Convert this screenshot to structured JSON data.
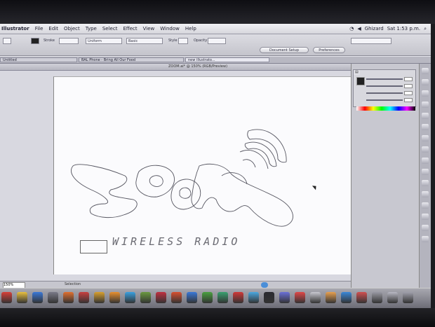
{
  "menubar": {
    "app_name": "Illustrator",
    "items": [
      "File",
      "Edit",
      "Object",
      "Type",
      "Select",
      "Effect",
      "View",
      "Window",
      "Help"
    ],
    "user": "Ghizard",
    "clock": "Sat 1:53 p.m."
  },
  "control_bar": {
    "stroke_label": "Stroke",
    "uniform_label": "Uniform",
    "basic_label": "Basic",
    "style_label": "Style",
    "opacity_label": "Opacity",
    "document_setup": "Document Setup",
    "preferences": "Preferences"
  },
  "tabs": [
    "Untitled",
    "BAL Phone - Bring All Our Food",
    "new illustrato..."
  ],
  "document_title": "ZOOM.ai* @ 150% (RGB/Preview)",
  "artwork": {
    "logo_text": "ZOOM",
    "tagline": "WIRELESS RADIO"
  },
  "status": {
    "zoom": "150%",
    "mode": "Selection"
  },
  "dock": {
    "icon_colors": [
      "#d8403a",
      "#e8c040",
      "#3a78d8",
      "#7a7a88",
      "#e07030",
      "#c84040",
      "#d8a030",
      "#e89030",
      "#3aa0e0",
      "#6a9a40",
      "#c03040",
      "#d85030",
      "#3a78d8",
      "#4aa040",
      "#3aa070",
      "#d03838",
      "#4aa8e0",
      "#2a2a30",
      "#6a70d8",
      "#e04848",
      "#c8c8d0",
      "#e8a050",
      "#3a88d8",
      "#d05050",
      "#9a9aa4",
      "#b8b8c4",
      "#a0a0ac"
    ]
  },
  "colors": {
    "artboard": "#fbfbfd",
    "outline": "#555560",
    "accent": "#4a8ed8"
  }
}
